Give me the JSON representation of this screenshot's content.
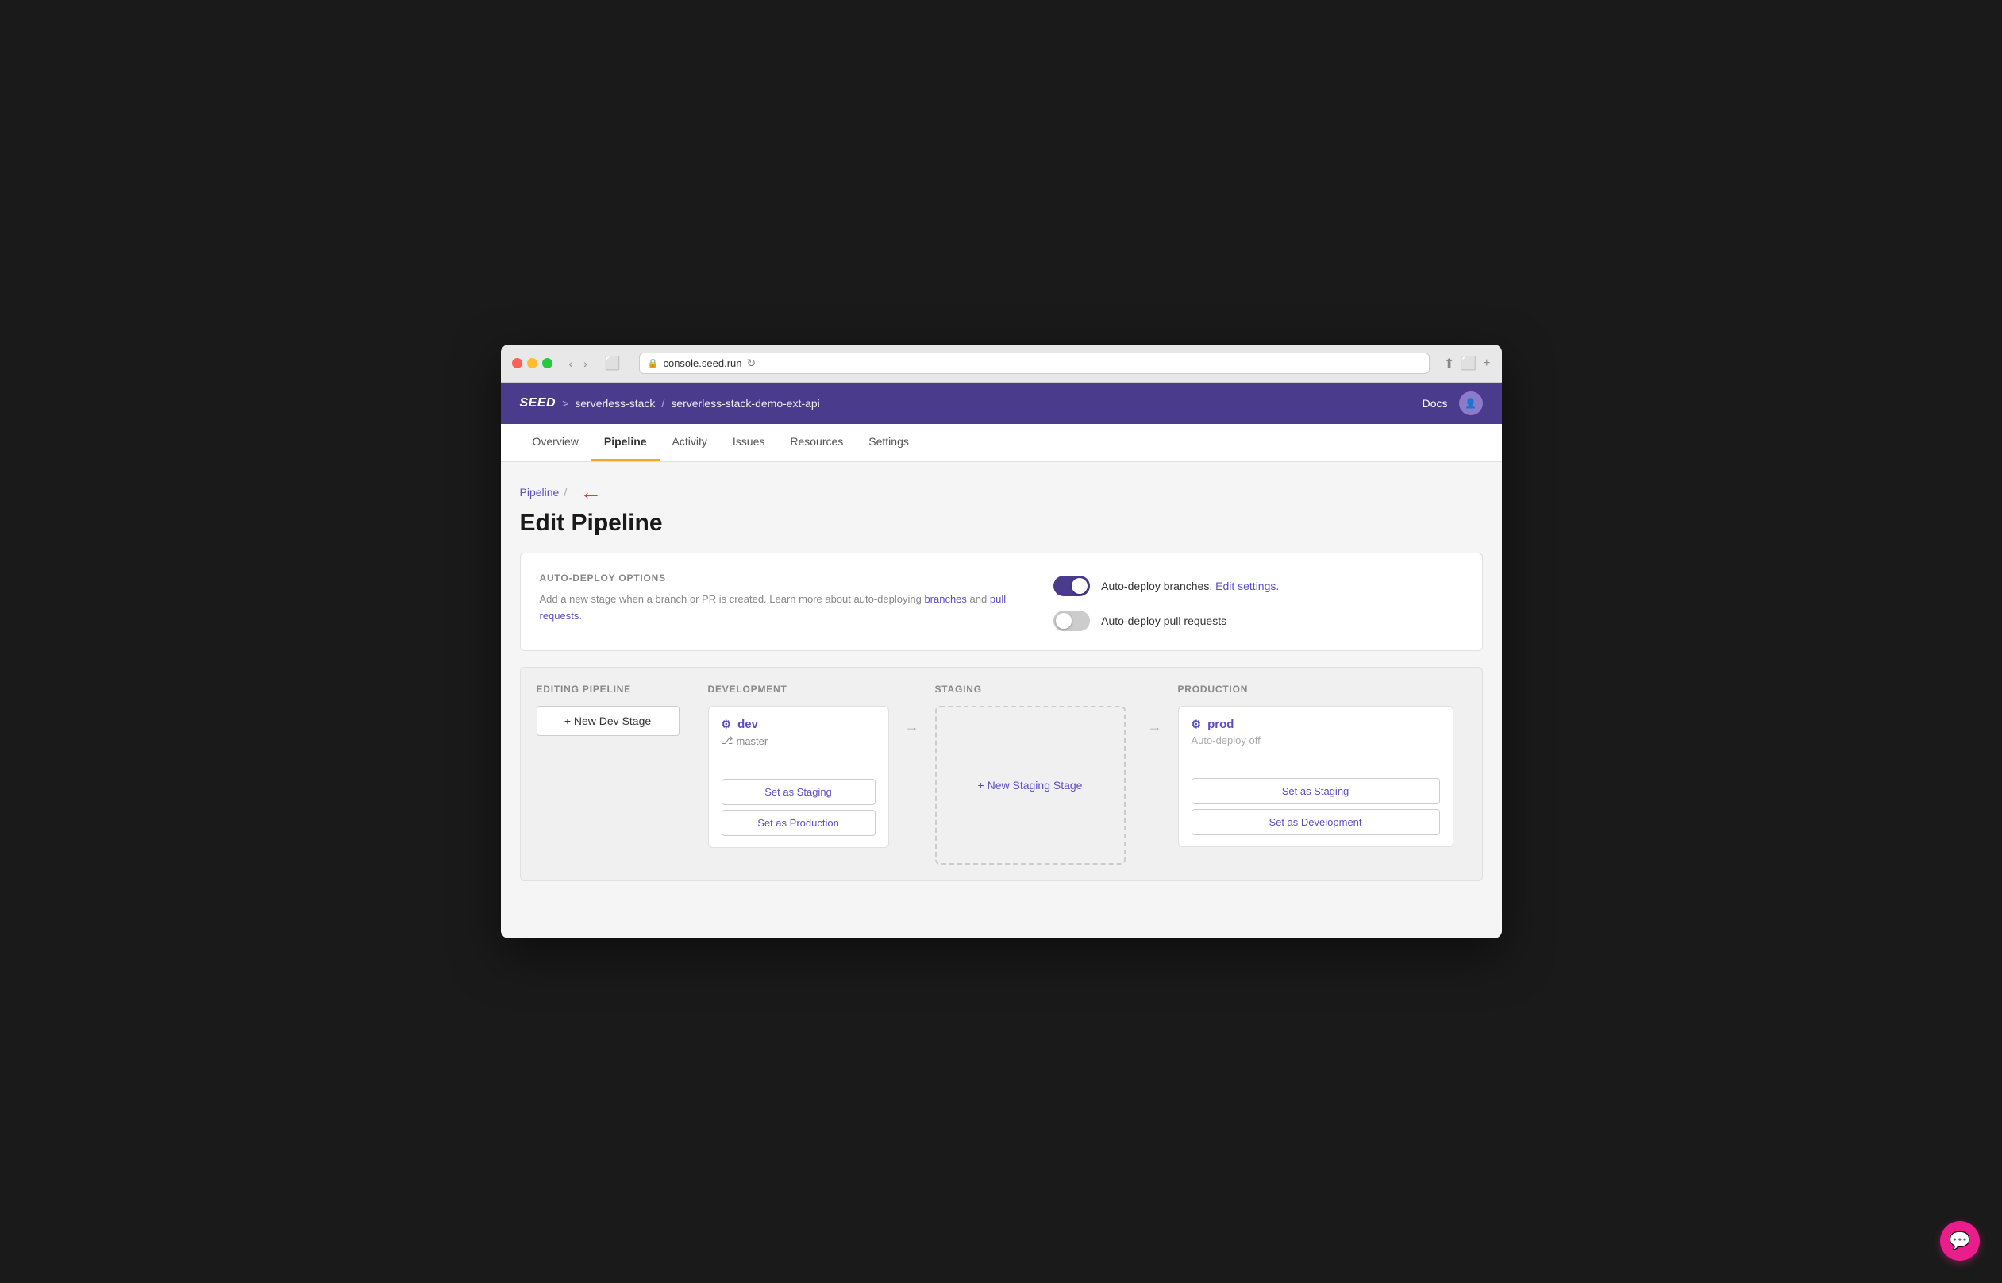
{
  "browser": {
    "address": "console.seed.run",
    "lock_icon": "🔒",
    "reload_icon": "↻"
  },
  "app_header": {
    "logo": "SEED",
    "breadcrumb_org": "serverless-stack",
    "breadcrumb_sep": ">",
    "breadcrumb_app": "serverless-stack-demo-ext-api",
    "docs_label": "Docs"
  },
  "nav_tabs": [
    {
      "label": "Overview",
      "active": false
    },
    {
      "label": "Pipeline",
      "active": true
    },
    {
      "label": "Activity",
      "active": false
    },
    {
      "label": "Issues",
      "active": false
    },
    {
      "label": "Resources",
      "active": false
    },
    {
      "label": "Settings",
      "active": false
    }
  ],
  "page": {
    "breadcrumb_link": "Pipeline",
    "title": "Edit Pipeline"
  },
  "auto_deploy": {
    "section_label": "AUTO-DEPLOY OPTIONS",
    "description": "Add a new stage when a branch or PR is created. Learn more about auto-deploying",
    "branches_link": "branches",
    "and_text": "and",
    "pull_requests_link": "pull requests",
    "period": ".",
    "toggle_branches_label": "Auto-deploy branches.",
    "edit_settings_link": "Edit settings.",
    "toggle_pr_label": "Auto-deploy pull requests",
    "branches_on": true,
    "pr_on": false
  },
  "pipeline": {
    "editing_label": "EDITING PIPELINE",
    "new_dev_stage_btn": "+ New Dev Stage",
    "development_label": "DEVELOPMENT",
    "staging_label": "STAGING",
    "production_label": "PRODUCTION",
    "dev_stage": {
      "name": "dev",
      "branch": "master",
      "branch_icon": "⎇",
      "set_staging_btn": "Set as Staging",
      "set_production_btn": "Set as Production"
    },
    "staging_placeholder": "+ New Staging Stage",
    "prod_stage": {
      "name": "prod",
      "auto_deploy": "Auto-deploy off",
      "set_staging_btn": "Set as Staging",
      "set_dev_btn": "Set as Development"
    }
  },
  "chat": {
    "icon": "💬"
  }
}
